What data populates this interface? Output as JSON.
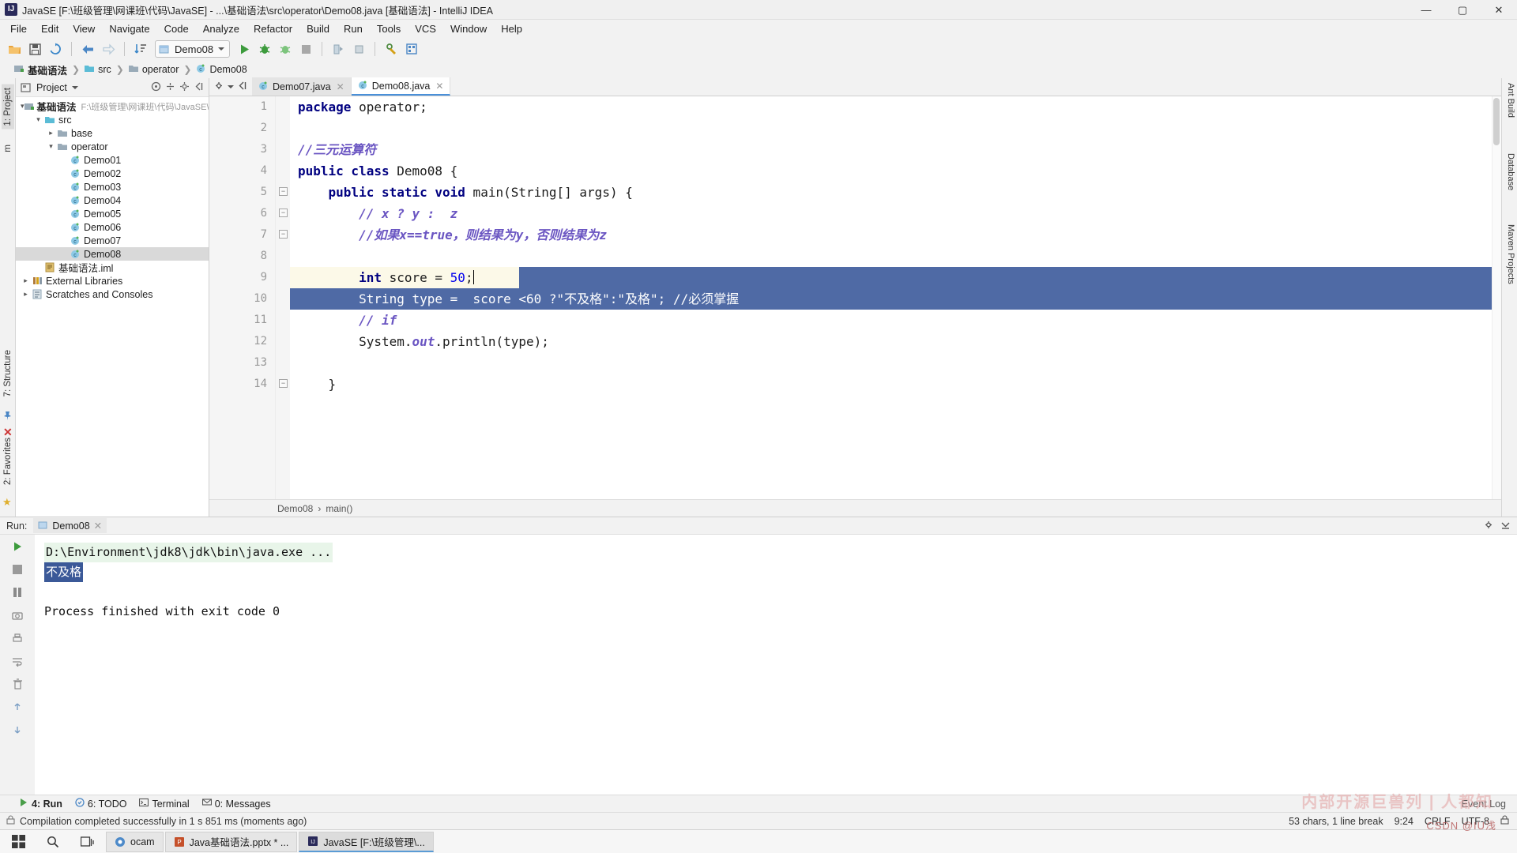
{
  "window": {
    "title": "JavaSE [F:\\班级管理\\网课班\\代码\\JavaSE] - ...\\基础语法\\src\\operator\\Demo08.java [基础语法] - IntelliJ IDEA",
    "logo": "IJ",
    "minimize": "—",
    "maximize": "▢",
    "close": "✕"
  },
  "menu": [
    "File",
    "Edit",
    "View",
    "Navigate",
    "Code",
    "Analyze",
    "Refactor",
    "Build",
    "Run",
    "Tools",
    "VCS",
    "Window",
    "Help"
  ],
  "toolbar": {
    "run_config": "Demo08",
    "icons": [
      "open-folder-icon",
      "save-all-icon",
      "sync-icon",
      "back-icon",
      "forward-icon",
      "sort-icon",
      "run-icon",
      "debug-icon",
      "run-coverage-icon",
      "stop-icon",
      "build-icon",
      "build-module-icon",
      "settings-icon",
      "structure-icon"
    ]
  },
  "breadcrumb": [
    {
      "label": "基础语法",
      "icon": "module-icon",
      "bold": true
    },
    {
      "label": "src",
      "icon": "source-folder-icon",
      "bold": false
    },
    {
      "label": "operator",
      "icon": "folder-icon",
      "bold": false
    },
    {
      "label": "Demo08",
      "icon": "class-icon",
      "bold": false
    }
  ],
  "left_strip": [
    {
      "label": "1: Project",
      "selected": true
    },
    {
      "label": "m",
      "selected": false
    }
  ],
  "left_strip_bottom": [
    "7: Structure",
    "2: Favorites"
  ],
  "right_strip": [
    "Ant Build",
    "Database",
    "Maven Projects"
  ],
  "project_panel": {
    "title": "Project",
    "actions": [
      "target-icon",
      "collapse-icon",
      "settings-icon",
      "hide-icon"
    ],
    "tree": [
      {
        "label": "基础语法",
        "path": "F:\\班级管理\\网课班\\代码\\JavaSE\\基础",
        "indent": 0,
        "arrow": "v",
        "icon": "module-icon",
        "bold": true,
        "selected": false
      },
      {
        "label": "src",
        "path": "",
        "indent": 1,
        "arrow": "v",
        "icon": "source-folder-icon",
        "bold": false,
        "selected": false
      },
      {
        "label": "base",
        "path": "",
        "indent": 2,
        "arrow": ">",
        "icon": "folder-icon",
        "bold": false,
        "selected": false
      },
      {
        "label": "operator",
        "path": "",
        "indent": 2,
        "arrow": "v",
        "icon": "folder-icon",
        "bold": false,
        "selected": false
      },
      {
        "label": "Demo01",
        "path": "",
        "indent": 3,
        "arrow": "",
        "icon": "class-icon",
        "bold": false,
        "selected": false
      },
      {
        "label": "Demo02",
        "path": "",
        "indent": 3,
        "arrow": "",
        "icon": "class-icon",
        "bold": false,
        "selected": false
      },
      {
        "label": "Demo03",
        "path": "",
        "indent": 3,
        "arrow": "",
        "icon": "class-icon",
        "bold": false,
        "selected": false
      },
      {
        "label": "Demo04",
        "path": "",
        "indent": 3,
        "arrow": "",
        "icon": "class-icon",
        "bold": false,
        "selected": false
      },
      {
        "label": "Demo05",
        "path": "",
        "indent": 3,
        "arrow": "",
        "icon": "class-icon",
        "bold": false,
        "selected": false
      },
      {
        "label": "Demo06",
        "path": "",
        "indent": 3,
        "arrow": "",
        "icon": "class-icon",
        "bold": false,
        "selected": false
      },
      {
        "label": "Demo07",
        "path": "",
        "indent": 3,
        "arrow": "",
        "icon": "class-icon",
        "bold": false,
        "selected": false
      },
      {
        "label": "Demo08",
        "path": "",
        "indent": 3,
        "arrow": "",
        "icon": "class-icon",
        "bold": false,
        "selected": true
      },
      {
        "label": "基础语法.iml",
        "path": "",
        "indent": 1,
        "arrow": "",
        "icon": "iml-icon",
        "bold": false,
        "selected": false
      },
      {
        "label": "External Libraries",
        "path": "",
        "indent": 0,
        "arrow": ">",
        "icon": "libraries-icon",
        "bold": false,
        "selected": false
      },
      {
        "label": "Scratches and Consoles",
        "path": "",
        "indent": 0,
        "arrow": ">",
        "icon": "scratches-icon",
        "bold": false,
        "selected": false
      }
    ]
  },
  "editor": {
    "tabs": [
      {
        "label": "Demo07.java",
        "active": false
      },
      {
        "label": "Demo08.java",
        "active": true
      }
    ],
    "lines": [
      {
        "no": "1",
        "runmark": false,
        "fold": "",
        "caretline": false,
        "selected": false,
        "tokens": [
          {
            "t": "package",
            "c": "kw"
          },
          {
            "t": " operator;",
            "c": ""
          }
        ],
        "indent": 0
      },
      {
        "no": "2",
        "runmark": false,
        "fold": "",
        "caretline": false,
        "selected": false,
        "tokens": [],
        "indent": 0
      },
      {
        "no": "3",
        "runmark": false,
        "fold": "",
        "caretline": false,
        "selected": false,
        "tokens": [
          {
            "t": "//三元运算符",
            "c": "cmt"
          }
        ],
        "indent": 0
      },
      {
        "no": "4",
        "runmark": true,
        "fold": "",
        "caretline": false,
        "selected": false,
        "tokens": [
          {
            "t": "public class",
            "c": "kw"
          },
          {
            "t": " Demo08 {",
            "c": ""
          }
        ],
        "indent": 0
      },
      {
        "no": "5",
        "runmark": true,
        "fold": "box",
        "caretline": false,
        "selected": false,
        "tokens": [
          {
            "t": "    ",
            "c": ""
          },
          {
            "t": "public static void",
            "c": "kw"
          },
          {
            "t": " main(String[] args) {",
            "c": ""
          }
        ],
        "indent": 0
      },
      {
        "no": "6",
        "runmark": false,
        "fold": "box",
        "caretline": false,
        "selected": false,
        "tokens": [
          {
            "t": "        ",
            "c": ""
          },
          {
            "t": "// x ? y :  z",
            "c": "cmt"
          }
        ],
        "indent": 0
      },
      {
        "no": "7",
        "runmark": false,
        "fold": "box",
        "caretline": false,
        "selected": false,
        "tokens": [
          {
            "t": "        ",
            "c": ""
          },
          {
            "t": "//如果x==true，则结果为y，否则结果为z",
            "c": "cmt"
          }
        ],
        "indent": 0
      },
      {
        "no": "8",
        "runmark": false,
        "fold": "",
        "caretline": false,
        "selected": false,
        "tokens": [],
        "indent": 0
      },
      {
        "no": "9",
        "runmark": false,
        "fold": "",
        "caretline": true,
        "selected": false,
        "tokens": [
          {
            "t": "        ",
            "c": ""
          },
          {
            "t": "int",
            "c": "kw"
          },
          {
            "t": " score = ",
            "c": ""
          },
          {
            "t": "50",
            "c": "num"
          },
          {
            "t": ";",
            "c": ""
          }
        ],
        "indent": 0
      },
      {
        "no": "10",
        "runmark": false,
        "fold": "",
        "caretline": false,
        "selected": true,
        "tokens": [
          {
            "t": "        String type =  score <60 ?\"不及格\":\"及格\"; //必须掌握",
            "c": ""
          }
        ],
        "indent": 0
      },
      {
        "no": "11",
        "runmark": false,
        "fold": "",
        "caretline": false,
        "selected": false,
        "tokens": [
          {
            "t": "        ",
            "c": ""
          },
          {
            "t": "// if",
            "c": "cmt"
          }
        ],
        "indent": 0
      },
      {
        "no": "12",
        "runmark": false,
        "fold": "",
        "caretline": false,
        "selected": false,
        "tokens": [
          {
            "t": "        System.",
            "c": ""
          },
          {
            "t": "out",
            "c": "cmt"
          },
          {
            "t": ".println(type);",
            "c": ""
          }
        ],
        "indent": 0
      },
      {
        "no": "13",
        "runmark": false,
        "fold": "",
        "caretline": false,
        "selected": false,
        "tokens": [],
        "indent": 0
      },
      {
        "no": "14",
        "runmark": false,
        "fold": "box",
        "caretline": false,
        "selected": false,
        "tokens": [
          {
            "t": "    }",
            "c": ""
          }
        ],
        "indent": 0
      }
    ],
    "status_crumb": [
      "Demo08",
      "main()"
    ]
  },
  "run_window": {
    "run_label": "Run:",
    "tab_label": "Demo08",
    "console": {
      "command": "D:\\Environment\\jdk8\\jdk\\bin\\java.exe ...",
      "output_selected": "不及格",
      "exit_line": "Process finished with exit code 0"
    },
    "side_icons": [
      "rerun-icon",
      "stop-icon",
      "pause-icon",
      "up-icon",
      "down-icon",
      "wrap-icon",
      "camera-icon",
      "print-icon",
      "clear-icon",
      "scroll-icon",
      "pin-icon",
      "close-icon"
    ],
    "header_right": [
      "gear-icon",
      "hide-icon"
    ]
  },
  "bottom_bar": {
    "items": [
      {
        "label": "4: Run",
        "icon": "run-icon",
        "active": true
      },
      {
        "label": "6: TODO",
        "icon": "todo-icon",
        "active": false
      },
      {
        "label": "Terminal",
        "icon": "terminal-icon",
        "active": false
      },
      {
        "label": "0: Messages",
        "icon": "messages-icon",
        "active": false
      }
    ],
    "right": "Event Log"
  },
  "status_bar": {
    "message": "Compilation completed successfully in 1 s 851 ms (moments ago)",
    "chars": "53 chars, 1 line break",
    "caret": "9:24",
    "line_sep": "CRLF",
    "encoding": "UTF-8",
    "lock": "lock-icon"
  },
  "taskbar": {
    "start": "start-icon",
    "search": "search-icon",
    "taskview": "taskview-icon",
    "apps": [
      {
        "label": "ocam",
        "icon": "ocam-icon",
        "selected": false
      },
      {
        "label": "Java基础语法.pptx * ...",
        "icon": "ppt-icon",
        "selected": false
      },
      {
        "label": "JavaSE [F:\\班级管理\\...",
        "icon": "idea-icon",
        "selected": true
      }
    ]
  },
  "watermark": {
    "line1": "内部开源巨兽列 | 人都知",
    "line2": "CSDN @IU浅"
  },
  "colors": {
    "accent": "#4a90d9",
    "selection": "#4f6aa5",
    "caret_line": "#fcf9e8",
    "keyword": "#000080",
    "comment": "#6a55c2",
    "console_cmd_bg": "#e8f5e9",
    "console_sel_bg": "#3b5998"
  }
}
